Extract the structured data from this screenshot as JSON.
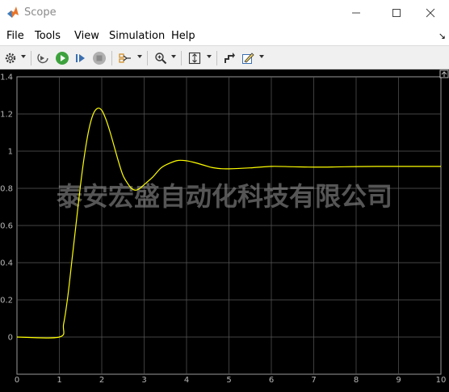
{
  "window": {
    "title": "Scope"
  },
  "menu": {
    "items": [
      {
        "label": "File"
      },
      {
        "label": "Tools"
      },
      {
        "label": "View"
      },
      {
        "label": "Simulation"
      },
      {
        "label": "Help"
      }
    ]
  },
  "toolbar": {
    "icons": [
      "settings-icon",
      "step-back-icon",
      "run-icon",
      "step-forward-icon",
      "stop-icon",
      "signal-selector-icon",
      "zoom-icon",
      "autoscale-icon",
      "highlight-block-icon",
      "style-icon"
    ]
  },
  "watermark": {
    "text": "泰安宏盛自动化科技有限公司"
  },
  "colors": {
    "signal": "#ffff00",
    "plot_background": "#000000",
    "grid": "#5a5a5a"
  },
  "chart_data": {
    "type": "line",
    "title": "",
    "xlabel": "",
    "ylabel": "",
    "grid": true,
    "xlim": [
      0,
      10
    ],
    "ylim": [
      -0.2,
      1.4
    ],
    "xticks": [
      "0",
      "1",
      "2",
      "3",
      "4",
      "5",
      "6",
      "7",
      "8",
      "9",
      "10"
    ],
    "yticks": [
      "0",
      "0.2",
      "0.4",
      "0.6",
      "0.8",
      "1",
      "1.2",
      "1.4"
    ],
    "series": [
      {
        "color": "#ffff00",
        "x": [
          0,
          1.0,
          1.1,
          1.2,
          1.3,
          1.4,
          1.5,
          1.6,
          1.7,
          1.8,
          1.9,
          2.0,
          2.1,
          2.2,
          2.3,
          2.4,
          2.5,
          2.6,
          2.7,
          2.8,
          2.9,
          3.0,
          3.2,
          3.4,
          3.6,
          3.8,
          4.0,
          4.2,
          4.4,
          4.6,
          4.8,
          5.0,
          5.5,
          6.0,
          6.5,
          7.0,
          7.5,
          8.0,
          8.5,
          9.0,
          9.5,
          10.0
        ],
        "y": [
          0,
          0,
          0.07,
          0.22,
          0.42,
          0.62,
          0.82,
          0.99,
          1.12,
          1.2,
          1.23,
          1.22,
          1.17,
          1.1,
          1.02,
          0.94,
          0.87,
          0.83,
          0.8,
          0.79,
          0.8,
          0.82,
          0.86,
          0.91,
          0.935,
          0.95,
          0.948,
          0.938,
          0.925,
          0.912,
          0.906,
          0.905,
          0.91,
          0.918,
          0.916,
          0.914,
          0.915,
          0.917,
          0.918,
          0.918,
          0.918,
          0.918
        ]
      }
    ]
  }
}
